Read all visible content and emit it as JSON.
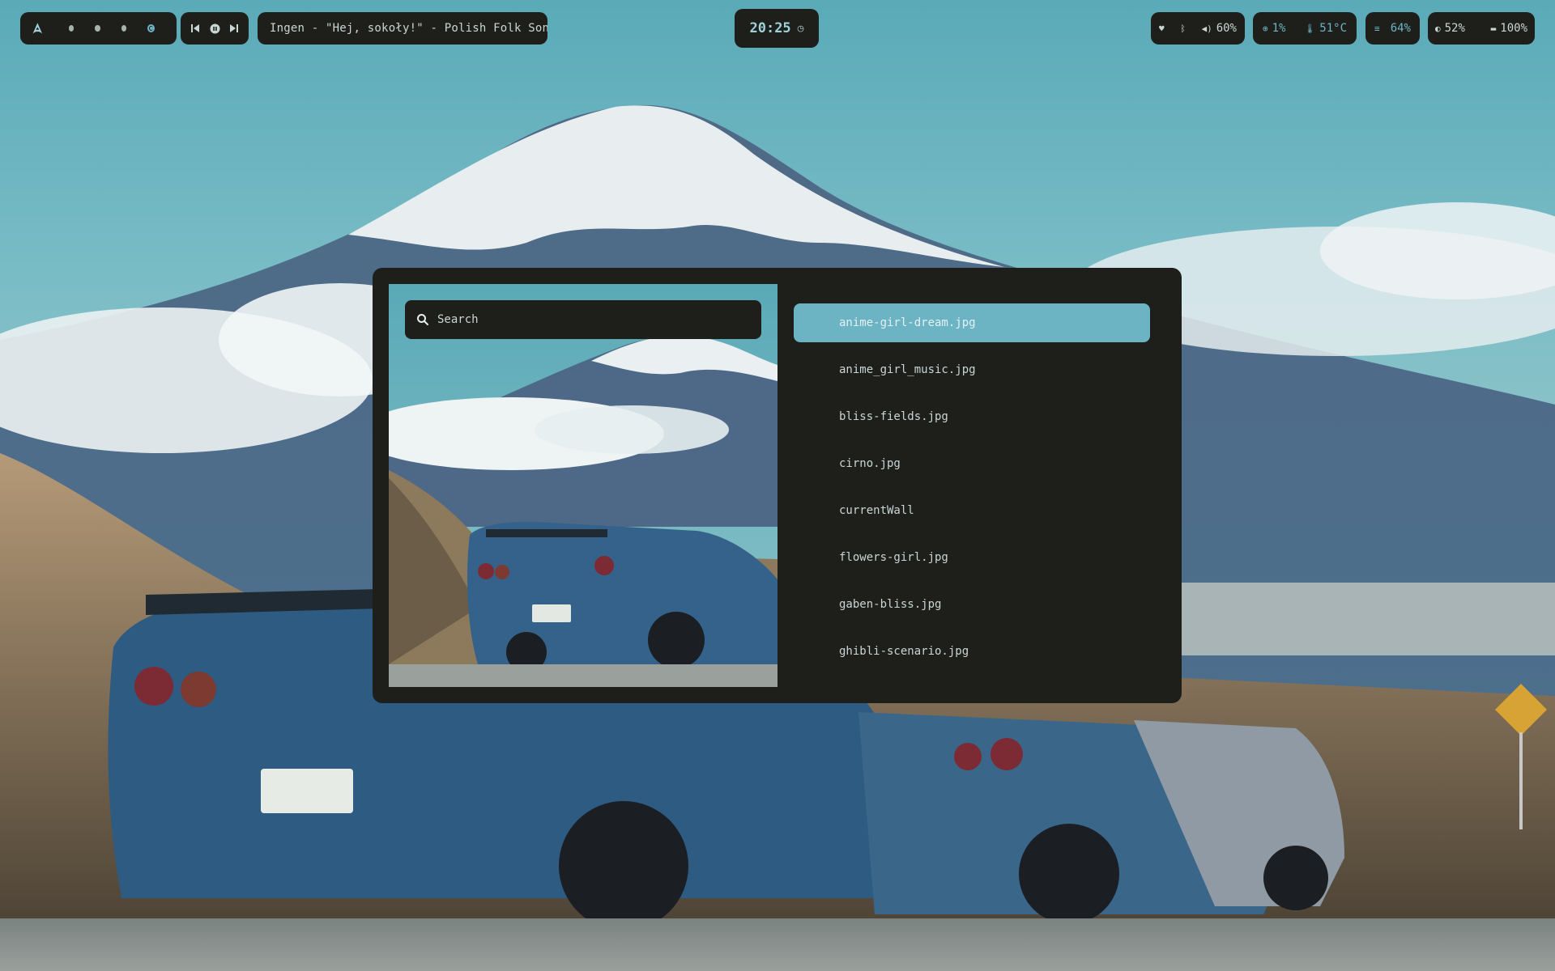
{
  "topbar": {
    "workspaces": {
      "logo_icon": "arch-logo-icon",
      "dots": [
        "workspace-1",
        "workspace-2",
        "workspace-3",
        "workspace-4"
      ],
      "active_index": 3
    },
    "media": {
      "prev_icon": "skip-previous-icon",
      "play_icon": "play-pause-icon",
      "next_icon": "skip-next-icon",
      "now_playing": "Ingen - \"Hej, sokoły!\" - Polish Folk Song"
    },
    "clock": {
      "time": "20:25",
      "icon": "clock-icon"
    },
    "system": {
      "wifi_icon": "wifi-icon",
      "bluetooth_icon": "bluetooth-icon",
      "volume_icon": "volume-icon",
      "volume": "60%",
      "cpu_icon": "cpu-icon",
      "cpu": "1%",
      "temp_icon": "thermometer-icon",
      "temperature": "51°C",
      "memory_icon": "memory-icon",
      "memory": "64%",
      "brightness_icon": "brightness-icon",
      "brightness": "52%",
      "battery_icon": "battery-icon",
      "battery": "100%"
    }
  },
  "picker": {
    "search": {
      "placeholder": "Search",
      "value": ""
    },
    "files": [
      "anime-girl-dream.jpg",
      "anime_girl_music.jpg",
      "bliss-fields.jpg",
      "cirno.jpg",
      "currentWall",
      "flowers-girl.jpg",
      "gaben-bliss.jpg",
      "ghibli-scenario.jpg"
    ],
    "selected_index": 0
  },
  "colors": {
    "bar_bg": "#1e1f1b",
    "accent": "#6cb3c3",
    "text": "#c9d6d6"
  }
}
